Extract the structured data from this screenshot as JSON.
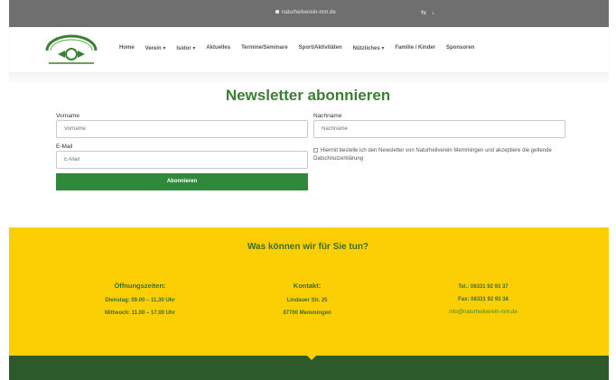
{
  "browser": {
    "url": "naturheilverein-mm.de",
    "icons": "⇆ ↓"
  },
  "nav": {
    "items": [
      {
        "label": "Home"
      },
      {
        "label": "Verein ▾"
      },
      {
        "label": "Isidor ▾"
      },
      {
        "label": "Aktuelles"
      },
      {
        "label": "Termine/Seminare"
      },
      {
        "label": "Sport/Aktivitäten"
      },
      {
        "label": "Nützliches ▾"
      },
      {
        "label": "Familie / Kinder"
      },
      {
        "label": "Sponsoren"
      }
    ]
  },
  "newsletter": {
    "title": "Newsletter abonnieren",
    "vorname_label": "Vorname",
    "vorname_placeholder": "Vorname",
    "nachname_label": "Nachname",
    "nachname_placeholder": "Nachname",
    "email_label": "E-Mail",
    "email_placeholder": "E-Mail",
    "consent_text": "Hiermit bestelle ich den Newsletter von Naturheilverein Memmingen und akzeptiere die geltende Datschnutzerklärung",
    "submit_label": "Abonnieren"
  },
  "footer": {
    "title": "Was können wir für Sie tun?",
    "hours": {
      "heading": "Öffnungszeiten:",
      "line1": "Dienstag: 09.00 – 11.30 Uhr",
      "line2": "Mittwoch: 11.00 – 17.00 Uhr"
    },
    "contact": {
      "heading": "Kontakt:",
      "line1": "Lindauer Str. 25",
      "line2": "87700 Memmingen"
    },
    "phone": {
      "tel": "Tel.: 08331 92 93 37",
      "fax": "Fax: 08331 92 93 38",
      "email": "info@naturheilverein-mm.de"
    }
  },
  "colors": {
    "brand_green": "#3a7f33",
    "button_green": "#2e8a3a",
    "footer_yellow": "#fccf05",
    "footer_dark_green": "#2c5a2a"
  }
}
